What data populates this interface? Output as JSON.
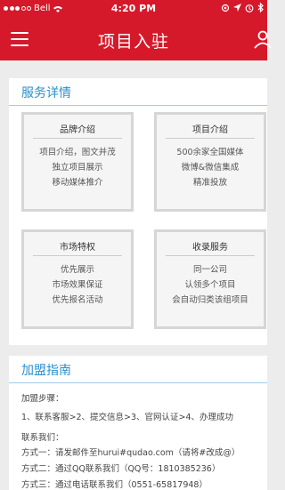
{
  "status_bar": {
    "carrier": "Bell",
    "time": "4:20 PM",
    "icons": [
      "signal-dots-icon",
      "wifi-icon",
      "orientation-lock-icon",
      "location-icon",
      "alarm-icon",
      "bluetooth-icon"
    ]
  },
  "navbar": {
    "title": "项目入驻",
    "left_icon": "menu-icon",
    "right_icon": "user-icon",
    "background": "#d6192a"
  },
  "service_section": {
    "title": "服务详情",
    "accent": "#2a8fcf",
    "cards": [
      {
        "title": "品牌介绍",
        "lines": [
          "项目介绍，图文并茂",
          "独立项目展示",
          "移动媒体推介"
        ]
      },
      {
        "title": "项目介绍",
        "lines": [
          "500余家全国媒体",
          "微博&微信集成",
          "精准投放"
        ]
      },
      {
        "title": "市场特权",
        "lines": [
          "优先展示",
          "市场效果保证",
          "优先报名活动"
        ]
      },
      {
        "title": "收录服务",
        "lines": [
          "同一公司",
          "认领多个项目",
          "会自动归类该组项目"
        ]
      }
    ]
  },
  "guide_section": {
    "title": "加盟指南",
    "steps_label": "加盟步骤：",
    "steps_text": "1、联系客服>2、提交信息>3、官网认证>4、办理成功",
    "contact_label": "联系我们：",
    "methods": [
      "方式一：请发邮件至hurui#qudao.com（请将#改成@）",
      "方式二：通过QQ联系我们（QQ号：1810385236）",
      "方式三：通过电话联系我们（0551-65817948）"
    ]
  }
}
